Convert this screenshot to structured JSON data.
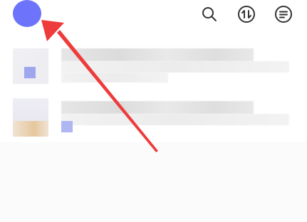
{
  "header": {
    "avatar_color": "#6d73fb",
    "icons": [
      "search-icon",
      "transfer-icon",
      "menu-icon"
    ]
  },
  "list": {
    "items": [
      {
        "thumbnail": "image-thumbnail",
        "blurred": true
      },
      {
        "thumbnail": "image-thumbnail",
        "blurred": true
      }
    ]
  },
  "annotation": {
    "type": "arrow",
    "color": "#ee3b3b",
    "target": "avatar"
  }
}
